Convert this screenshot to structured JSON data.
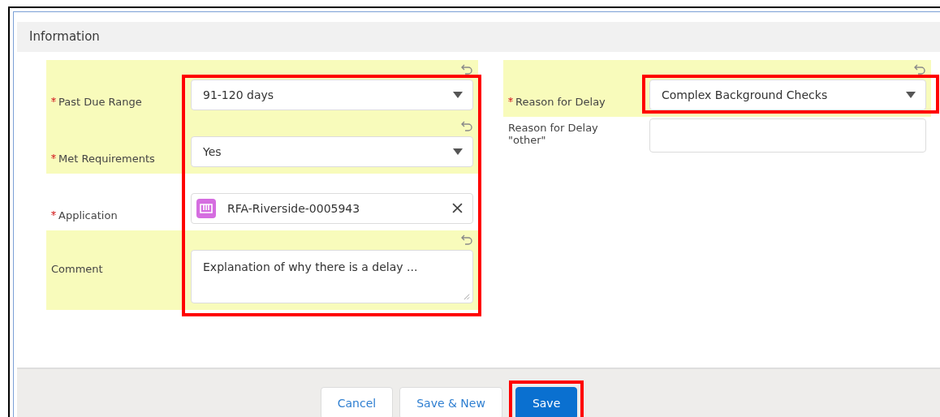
{
  "section": {
    "title": "Information"
  },
  "columns": [
    {
      "fields": [
        {
          "label": "Past Due Range",
          "required": true,
          "kind": "select",
          "value": "91-120 days",
          "changed": true,
          "outlined": true
        },
        {
          "label": "Met Requirements",
          "required": true,
          "kind": "select",
          "value": "Yes",
          "changed": true,
          "outlined": true
        },
        {
          "label": "Application",
          "required": true,
          "kind": "lookup",
          "value": "RFA-Riverside-0005943",
          "changed": false,
          "outlined": true
        },
        {
          "label": "Comment",
          "required": false,
          "kind": "textarea",
          "value": "Explanation of why there is a delay ...",
          "changed": true,
          "outlined": true
        }
      ]
    },
    {
      "fields": [
        {
          "label": "Reason for Delay",
          "required": true,
          "kind": "select",
          "value": "Complex Background Checks",
          "changed": true,
          "outlined": true
        },
        {
          "label": "Reason for Delay \"other\"",
          "required": false,
          "kind": "text",
          "changed": false,
          "outlined": false
        }
      ]
    }
  ],
  "buttons": [
    {
      "label": "Cancel",
      "kind": "neutral",
      "outlined": false
    },
    {
      "label": "Save & New",
      "kind": "neutral",
      "outlined": false
    },
    {
      "label": "Save",
      "kind": "brand",
      "outlined": true
    }
  ]
}
